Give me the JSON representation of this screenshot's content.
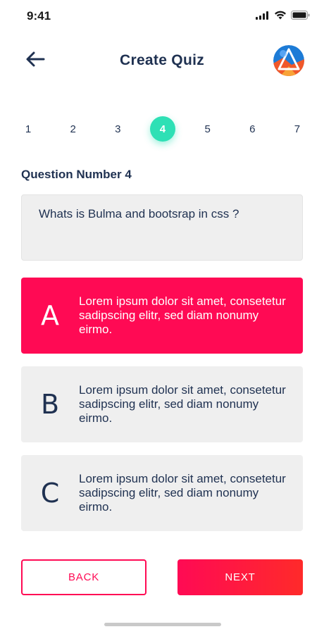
{
  "status_bar": {
    "time": "9:41"
  },
  "header": {
    "title": "Create Quiz",
    "back_icon": "arrow-left-icon",
    "avatar_icon": "user-avatar"
  },
  "stepper": {
    "steps": [
      "1",
      "2",
      "3",
      "4",
      "5",
      "6",
      "7"
    ],
    "active_step": "4",
    "active_color": "#2ee0b5"
  },
  "question": {
    "label": "Question Number 4",
    "text": "Whats is Bulma and bootsrap in css ?"
  },
  "answers": [
    {
      "letter": "A",
      "text": "Lorem ipsum dolor sit amet, consetetur sadipscing elitr, sed diam nonumy eirmo.",
      "selected": true
    },
    {
      "letter": "B",
      "text": "Lorem ipsum dolor sit amet, consetetur sadipscing elitr, sed diam nonumy eirmo.",
      "selected": false
    },
    {
      "letter": "C",
      "text": "Lorem ipsum dolor sit amet, consetetur sadipscing elitr, sed diam nonumy eirmo.",
      "selected": false
    }
  ],
  "buttons": {
    "back_label": "BACK",
    "next_label": "NEXT"
  },
  "colors": {
    "accent": "#ff0a54",
    "text": "#1f3151",
    "card_bg": "#efefef"
  }
}
